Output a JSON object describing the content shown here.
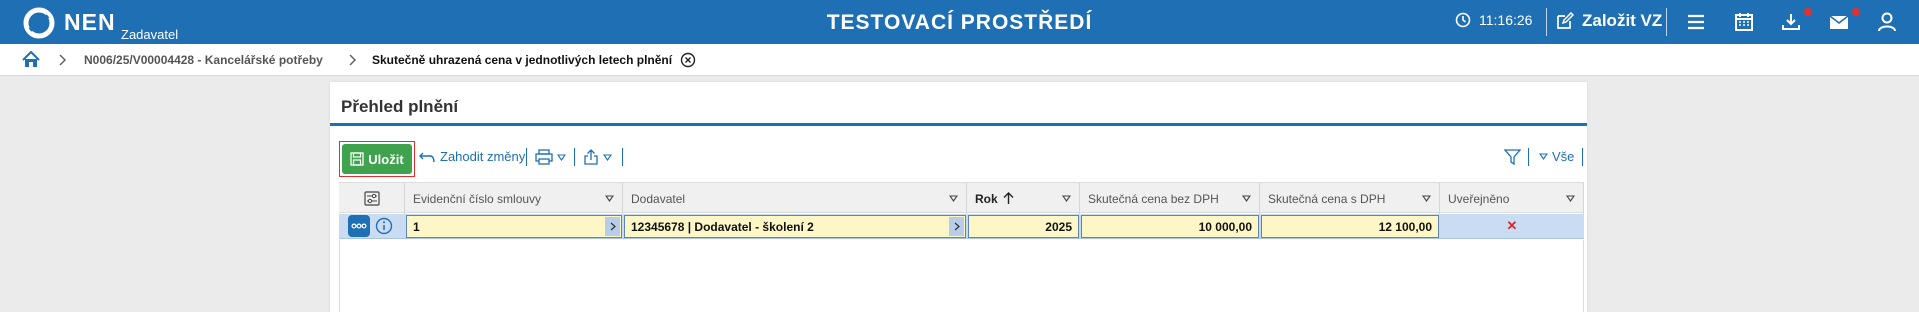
{
  "header": {
    "logo_text": "NEN",
    "logo_sub": "Zadavatel",
    "env_title": "TESTOVACÍ PROSTŘEDÍ",
    "time": "11:16:26",
    "create_label": "Založit VZ",
    "icons": [
      "clock-icon",
      "edit-icon",
      "menu-icon",
      "calendar-icon",
      "download-icon",
      "mail-icon",
      "user-icon"
    ],
    "brand_color": "#1f6fb4",
    "notification_color": "#e0302d"
  },
  "breadcrumb": {
    "items": [
      "N006/25/V00004428 - Kancelářské potřeby",
      "Skutečně uhrazená cena v jednotlivých letech plnění"
    ]
  },
  "panel": {
    "title": "Přehled plnění"
  },
  "toolbar": {
    "save_label": "Uložit",
    "discard_label": "Zahodit změny",
    "filter_all_label": "Vše",
    "save_color": "#3fa34d"
  },
  "grid": {
    "columns": [
      "Evidenční číslo smlouvy",
      "Dodavatel",
      "Rok",
      "Skutečná cena bez DPH",
      "Skutečná cena s DPH",
      "Uveřejněno"
    ],
    "sorted_column": "Rok",
    "rows": [
      {
        "contract_no": "1",
        "supplier": "12345678 | Dodavatel - školení 2",
        "year": "2025",
        "price_without_vat": "10 000,00",
        "price_with_vat": "12 100,00",
        "published": "✕"
      }
    ]
  }
}
